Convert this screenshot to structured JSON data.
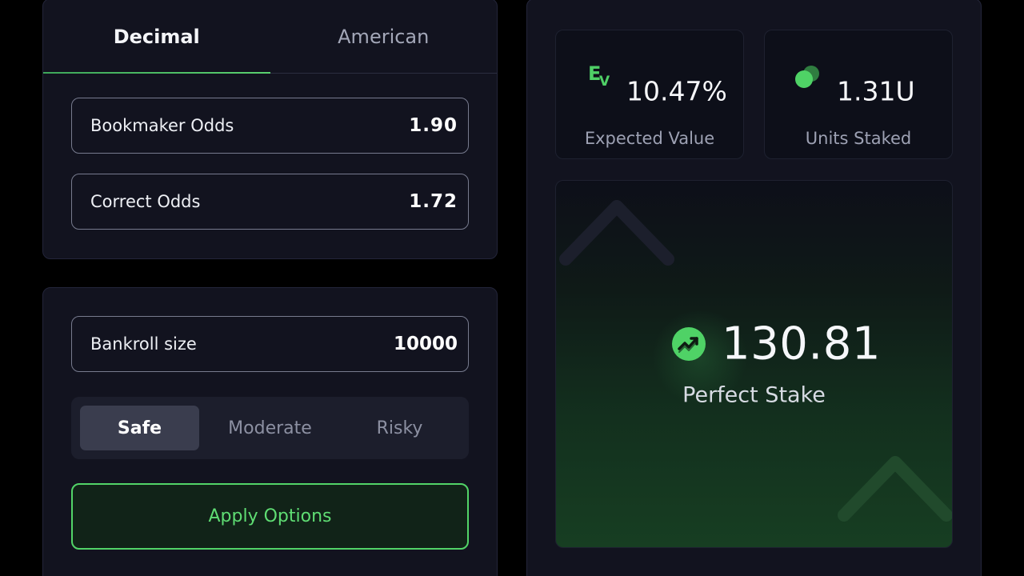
{
  "odds_format": {
    "tabs": [
      {
        "label": "Decimal",
        "active": true
      },
      {
        "label": "American",
        "active": false
      }
    ]
  },
  "odds_inputs": {
    "bookmaker": {
      "label": "Bookmaker Odds",
      "value": "1.90"
    },
    "correct": {
      "label": "Correct Odds",
      "value": "1.72"
    }
  },
  "bankroll": {
    "label": "Bankroll size",
    "value": "10000"
  },
  "risk": {
    "options": [
      "Safe",
      "Moderate",
      "Risky"
    ],
    "selected": "Safe"
  },
  "apply_label": "Apply Options",
  "stats": {
    "ev": {
      "value": "10.47%",
      "label": "Expected Value",
      "icon": "ev-icon"
    },
    "units": {
      "value": "1.31U",
      "label": "Units Staked",
      "icon": "units-dots-icon"
    }
  },
  "stake": {
    "value": "130.81",
    "label": "Perfect Stake",
    "icon": "trend-up-check-icon"
  },
  "colors": {
    "accent": "#4fd266",
    "panel": "#12131f",
    "background": "#000000"
  }
}
